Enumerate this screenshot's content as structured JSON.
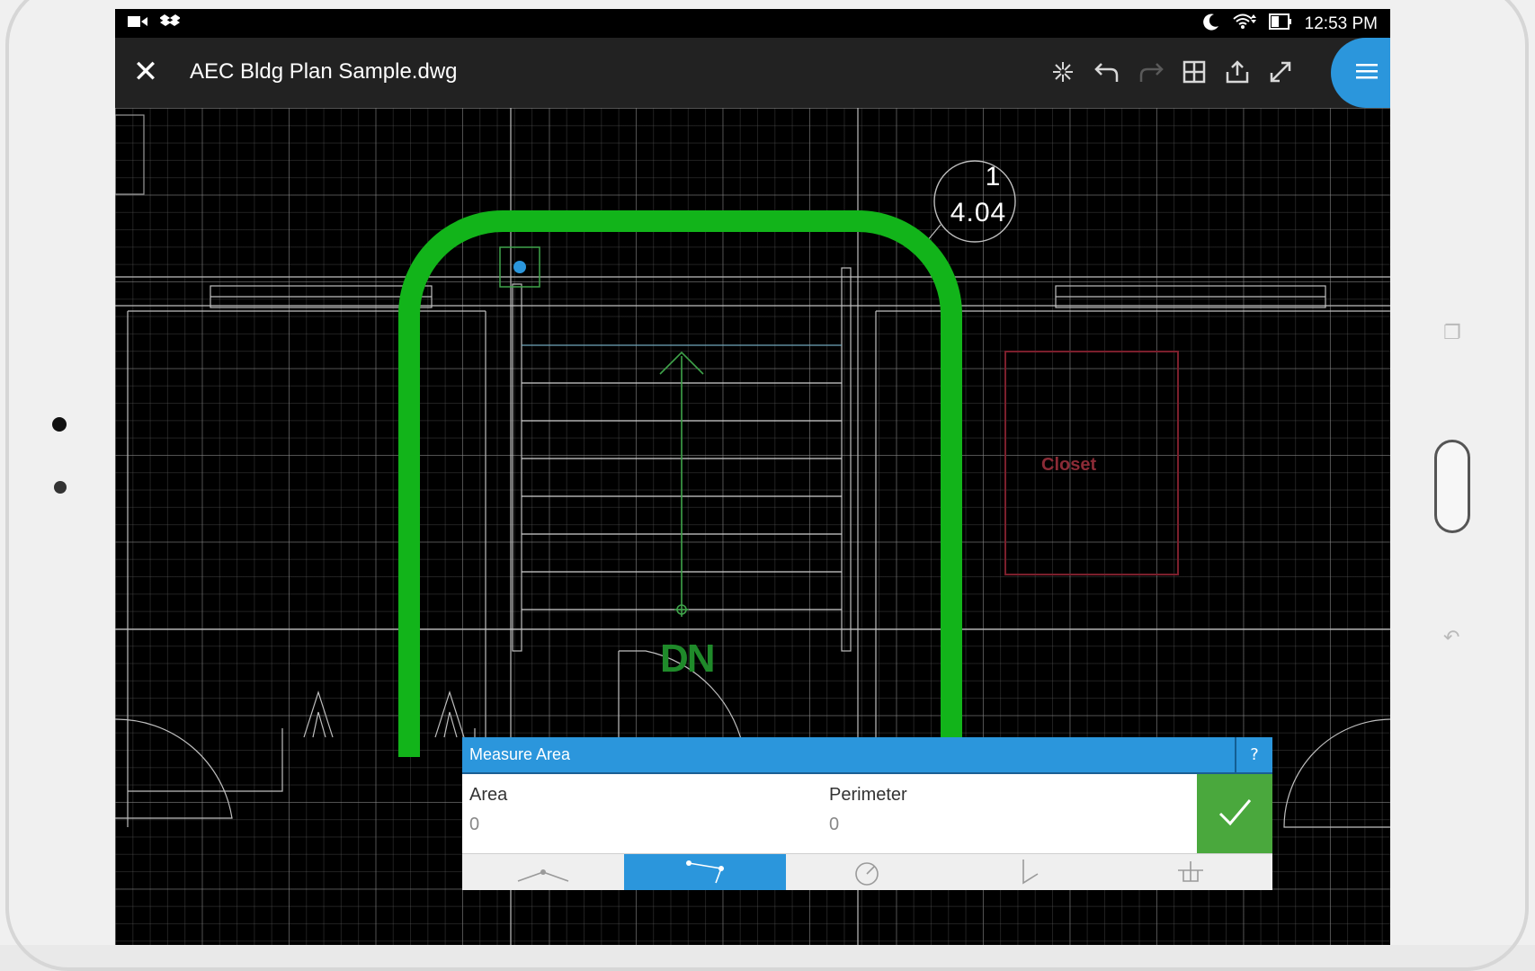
{
  "status_bar": {
    "time": "12:53 PM",
    "icons": [
      "video-icon",
      "dropbox-icon",
      "moon-icon",
      "wifi-icon",
      "battery-icon"
    ]
  },
  "app_bar": {
    "title": "AEC Bldg Plan Sample.dwg",
    "tools": [
      "magic-snap-icon",
      "undo-icon",
      "redo-icon",
      "grid-icon",
      "share-icon",
      "fullscreen-icon",
      "menu-icon"
    ]
  },
  "drawing": {
    "room_label": "Closet",
    "stair_label": "DN",
    "section_tag_number": "1",
    "section_tag_sheet": "4.04",
    "colors": {
      "highlight": "#12b41a",
      "closet": "#7b1f2c",
      "grid": "#5f5f5f"
    }
  },
  "measure_panel": {
    "title": "Measure Area",
    "help_label": "?",
    "area_label": "Area",
    "area_value": "0",
    "perimeter_label": "Perimeter",
    "perimeter_value": "0",
    "tabs": [
      "measure-distance-icon",
      "measure-area-icon",
      "measure-angle-icon",
      "measure-arc-icon",
      "measure-radius-icon"
    ],
    "active_tab": "measure-area-icon",
    "colors": {
      "header": "#2b96dc",
      "confirm": "#4aa83d"
    }
  }
}
